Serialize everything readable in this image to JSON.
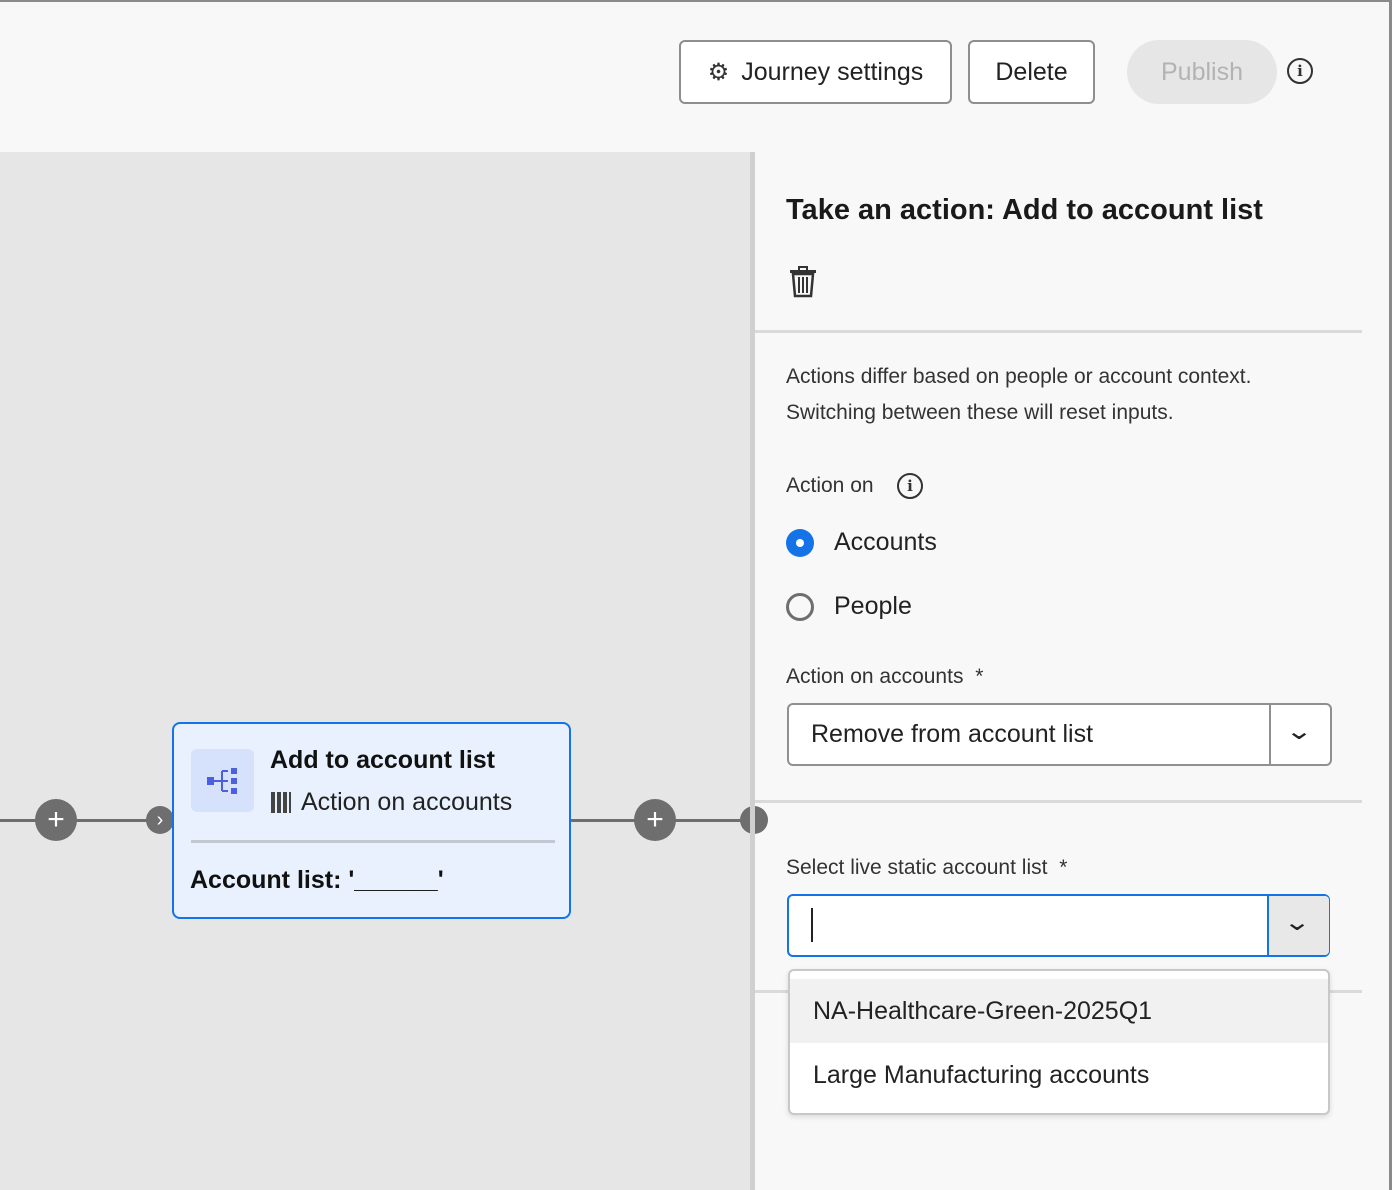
{
  "header": {
    "journey_settings": "Journey settings",
    "delete": "Delete",
    "publish": "Publish"
  },
  "node": {
    "title": "Add to account list",
    "subtitle": "Action on accounts",
    "detail": "Account list: '______'"
  },
  "panel": {
    "title": "Take an action: Add to account list",
    "description_line1": "Actions differ based on people or account context.",
    "description_line2": "Switching between these will reset inputs.",
    "action_on_label": "Action on",
    "radio_options": [
      {
        "label": "Accounts",
        "selected": true
      },
      {
        "label": "People",
        "selected": false
      }
    ],
    "action_on_accounts_label": "Action on accounts",
    "action_on_accounts_value": "Remove from account list",
    "required_mark": "*",
    "select_list_label": "Select live static account list",
    "select_list_value": "",
    "options": [
      "NA-Healthcare-Green-2025Q1",
      "Large Manufacturing accounts"
    ]
  },
  "colors": {
    "accent": "#1473e6",
    "card_bg": "#e8f1fd",
    "canvas_bg": "#e6e6e6"
  }
}
